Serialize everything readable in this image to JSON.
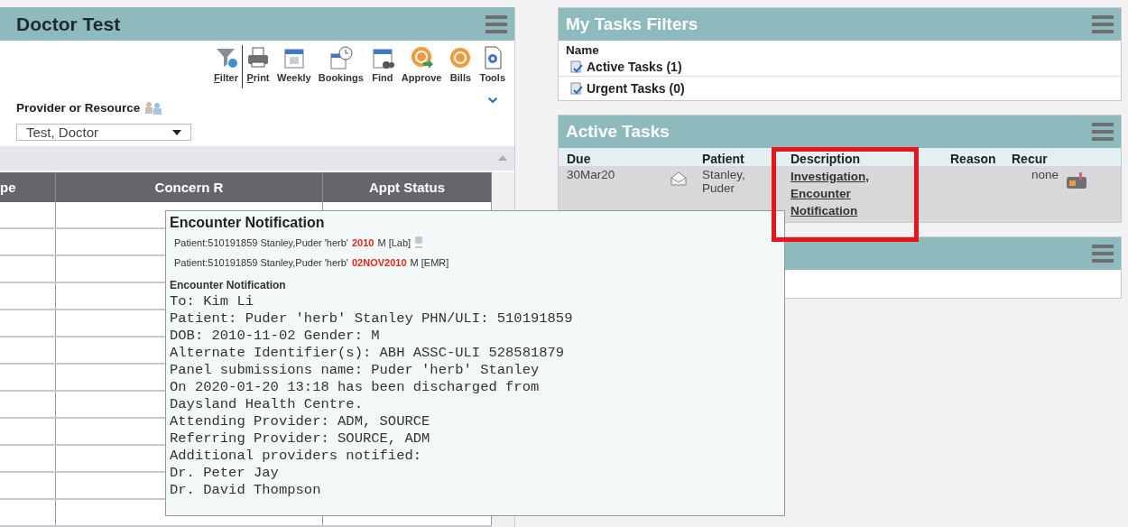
{
  "schedule_panel": {
    "title": "Doctor Test",
    "toolbar": [
      {
        "label": "Filter",
        "kind": "filter",
        "accelerator": true
      },
      {
        "label": "Print",
        "kind": "print",
        "accelerator": true
      },
      {
        "label": "Weekly",
        "kind": "calendar",
        "accelerator": false
      },
      {
        "label": "Bookings",
        "kind": "bookings",
        "accelerator": false
      },
      {
        "label": "Find",
        "kind": "find",
        "accelerator": false
      },
      {
        "label": "Approve",
        "kind": "approve",
        "accelerator": false
      },
      {
        "label": "Bills",
        "kind": "bills",
        "accelerator": false
      },
      {
        "label": "Tools",
        "kind": "tools",
        "accelerator": false
      }
    ],
    "provider_label": "Provider or Resource",
    "provider_value": "Test, Doctor",
    "table": {
      "columns": [
        "pe",
        "Concern R",
        "Appt Status"
      ]
    }
  },
  "tasks_filters": {
    "title": "My Tasks Filters",
    "column": "Name",
    "items": [
      {
        "label": "Active Tasks (1)"
      },
      {
        "label": "Urgent Tasks (0)"
      }
    ]
  },
  "active_tasks": {
    "title": "Active Tasks",
    "columns": [
      "Due",
      "Patient",
      "Description",
      "Reason",
      "Recur"
    ],
    "rows": [
      {
        "due": "30Mar20",
        "patient": "Stanley, Puder",
        "description": "Investigation, Encounter Notification",
        "recur": "none",
        "highlighted": true
      }
    ]
  },
  "popup": {
    "title": "Encounter Notification",
    "patient_lines": [
      {
        "text": "Patient:510191859 Stanley,Puder 'herb'",
        "date": "2010",
        "suffix": "M [Lab]",
        "icon": true
      },
      {
        "text": "Patient:510191859 Stanley,Puder 'herb'",
        "date": "02NOV2010",
        "suffix": "M [EMR]",
        "icon": false
      }
    ],
    "subtitle": "Encounter Notification",
    "body": [
      "To: Kim Li",
      "Patient: Puder 'herb' Stanley PHN/ULI: 510191859",
      "DOB: 2010-11-02 Gender: M",
      "Alternate Identifier(s): ABH ASSC-ULI 528581879",
      "Panel submissions name: Puder 'herb' Stanley",
      "On 2020-01-20 13:18 has been discharged from",
      "Daysland Health Centre.",
      "Attending Provider: ADM, SOURCE",
      "Referring Provider: SOURCE, ADM",
      "Additional providers notified:",
      "Dr. Peter Jay",
      "Dr. David Thompson"
    ]
  }
}
